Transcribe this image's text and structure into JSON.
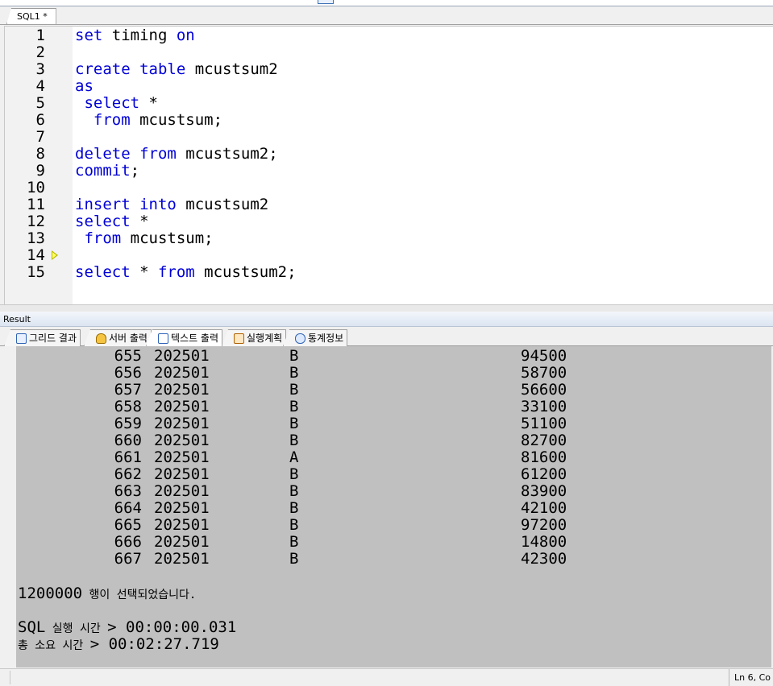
{
  "editor": {
    "tab_label": "SQL1 *",
    "line_numbers": [
      "1",
      "2",
      "3",
      "4",
      "5",
      "6",
      "7",
      "8",
      "9",
      "10",
      "11",
      "12",
      "13",
      "14",
      "15"
    ],
    "lines": [
      [
        {
          "t": "set",
          "k": true
        },
        {
          "t": " timing "
        },
        {
          "t": "on",
          "k": true
        }
      ],
      [],
      [
        {
          "t": "create",
          "k": true
        },
        {
          "t": " "
        },
        {
          "t": "table",
          "k": true
        },
        {
          "t": " mcustsum2"
        }
      ],
      [
        {
          "t": "as",
          "k": true
        }
      ],
      [
        {
          "t": " "
        },
        {
          "t": "select",
          "k": true
        },
        {
          "t": " *"
        }
      ],
      [
        {
          "t": "  "
        },
        {
          "t": "from",
          "k": true
        },
        {
          "t": " mcustsum;"
        }
      ],
      [],
      [
        {
          "t": "delete",
          "k": true
        },
        {
          "t": " "
        },
        {
          "t": "from",
          "k": true
        },
        {
          "t": " mcustsum2;"
        }
      ],
      [
        {
          "t": "commit",
          "k": true
        },
        {
          "t": ";"
        }
      ],
      [],
      [
        {
          "t": "insert",
          "k": true
        },
        {
          "t": " "
        },
        {
          "t": "into",
          "k": true
        },
        {
          "t": " mcustsum2"
        }
      ],
      [
        {
          "t": "select",
          "k": true
        },
        {
          "t": " *"
        }
      ],
      [
        {
          "t": " "
        },
        {
          "t": "from",
          "k": true
        },
        {
          "t": " mcustsum;"
        }
      ],
      [],
      [
        {
          "t": "select",
          "k": true
        },
        {
          "t": " * "
        },
        {
          "t": "from",
          "k": true
        },
        {
          "t": " mcustsum2;"
        }
      ]
    ],
    "current_line": 14,
    "keyword_color": "#0000d6"
  },
  "result": {
    "header_label": "Result",
    "tabs": [
      {
        "label": "그리드 결과",
        "icon": "grid-icon"
      },
      {
        "label": "서버 출력",
        "icon": "server-output-icon"
      },
      {
        "label": "텍스트 출력",
        "icon": "text-output-icon",
        "active": true
      },
      {
        "label": "실행계획",
        "icon": "execution-plan-icon"
      },
      {
        "label": "통계정보",
        "icon": "statistics-icon"
      }
    ],
    "rows": [
      [
        "655",
        "202501",
        "B",
        "94500"
      ],
      [
        "656",
        "202501",
        "B",
        "58700"
      ],
      [
        "657",
        "202501",
        "B",
        "56600"
      ],
      [
        "658",
        "202501",
        "B",
        "33100"
      ],
      [
        "659",
        "202501",
        "B",
        "51100"
      ],
      [
        "660",
        "202501",
        "B",
        "82700"
      ],
      [
        "661",
        "202501",
        "A",
        "81600"
      ],
      [
        "662",
        "202501",
        "B",
        "61200"
      ],
      [
        "663",
        "202501",
        "B",
        "83900"
      ],
      [
        "664",
        "202501",
        "B",
        "42100"
      ],
      [
        "665",
        "202501",
        "B",
        "97200"
      ],
      [
        "666",
        "202501",
        "B",
        "14800"
      ],
      [
        "667",
        "202501",
        "B",
        "42300"
      ]
    ],
    "rows_selected_count": "1200000",
    "rows_selected_suffix": " 행이 선택되었습니다.",
    "sql_exec_prefix": "SQL",
    "sql_exec_label": " 실행 시간 ",
    "sql_exec_value": "> 00:00:00.031",
    "total_label": "총 소요 시간 ",
    "total_value": "> 00:02:27.719",
    "output_background": "#c0c0c0"
  },
  "status": {
    "position": "Ln 6, Co"
  }
}
